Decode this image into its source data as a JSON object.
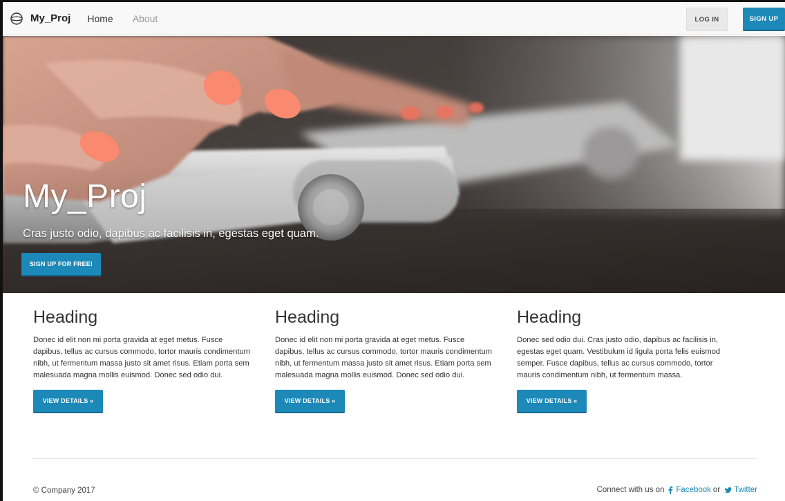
{
  "navbar": {
    "brand": "My_Proj",
    "brand_icon": "globe-icon",
    "links": [
      {
        "label": "Home",
        "state": "active"
      },
      {
        "label": "About",
        "state": "inactive"
      }
    ],
    "login_label": "LOG IN",
    "signup_label": "SIGN UP"
  },
  "hero": {
    "title": "My_Proj",
    "subtitle": "Cras justo odio, dapibus ac facilisis in, egestas eget quam.",
    "cta_label": "SIGN UP FOR FREE!"
  },
  "columns": [
    {
      "heading": "Heading",
      "body": "Donec id elit non mi porta gravida at eget metus. Fusce dapibus, tellus ac cursus commodo, tortor mauris condimentum nibh, ut fermentum massa justo sit amet risus. Etiam porta sem malesuada magna mollis euismod. Donec sed odio dui.",
      "button_label": "VIEW DETAILS »"
    },
    {
      "heading": "Heading",
      "body": "Donec id elit non mi porta gravida at eget metus. Fusce dapibus, tellus ac cursus commodo, tortor mauris condimentum nibh, ut fermentum massa justo sit amet risus. Etiam porta sem malesuada magna mollis euismod. Donec sed odio dui.",
      "button_label": "VIEW DETAILS »"
    },
    {
      "heading": "Heading",
      "body": "Donec sed odio dui. Cras justo odio, dapibus ac facilisis in, egestas eget quam. Vestibulum id ligula porta felis euismod semper. Fusce dapibus, tellus ac cursus commodo, tortor mauris condimentum nibh, ut fermentum massa.",
      "button_label": "VIEW DETAILS »"
    }
  ],
  "footer": {
    "copyright": "© Company 2017",
    "connect_prefix": "Connect with us on",
    "facebook_label": "Facebook",
    "or_label": "or",
    "twitter_label": "Twitter"
  },
  "colors": {
    "accent": "#1c89b8",
    "navbar_bg": "#f8f8f8"
  }
}
